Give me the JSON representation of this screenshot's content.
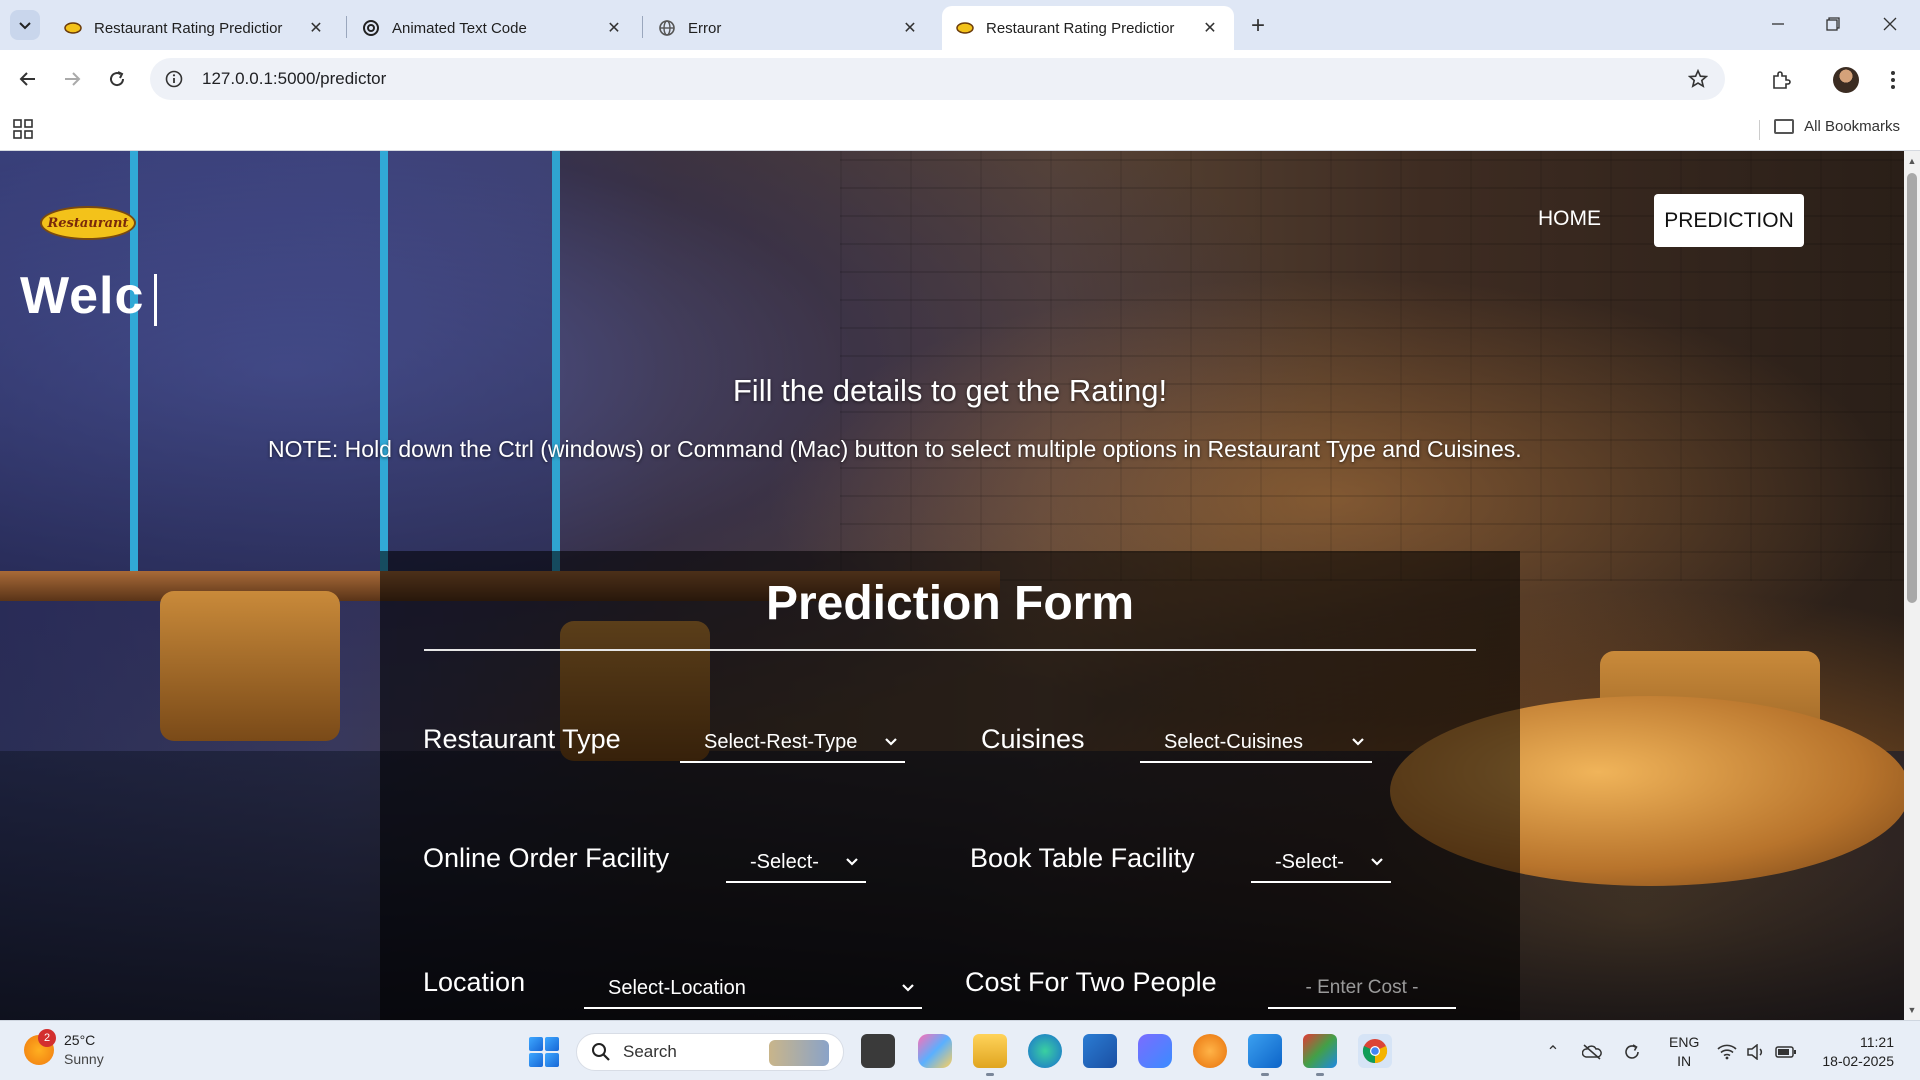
{
  "browser": {
    "tabs": [
      {
        "title": "Restaurant Rating Predictior",
        "active": false
      },
      {
        "title": "Animated Text Code",
        "active": false
      },
      {
        "title": "Error",
        "active": false
      },
      {
        "title": "Restaurant Rating Predictior",
        "active": true
      }
    ],
    "url": "127.0.0.1:5000/predictor",
    "bookmarks_label": "All Bookmarks"
  },
  "site": {
    "logo_text": "Restaurant",
    "nav": {
      "home": "HOME",
      "prediction": "PREDICTION"
    },
    "welcome_text": "Welc",
    "headline": "Fill the details to get the Rating!",
    "note": "NOTE: Hold down the Ctrl (windows) or Command (Mac) button to select multiple options in Restaurant Type and Cuisines.",
    "form": {
      "title": "Prediction Form",
      "fields": {
        "restaurant_type": {
          "label": "Restaurant Type",
          "value": "Select-Rest-Type"
        },
        "cuisines": {
          "label": "Cuisines",
          "value": "Select-Cuisines"
        },
        "online_order": {
          "label": "Online Order Facility",
          "value": "-Select-"
        },
        "book_table": {
          "label": "Book Table Facility",
          "value": "-Select-"
        },
        "location": {
          "label": "Location",
          "value": "Select-Location"
        },
        "cost": {
          "label": "Cost For Two People",
          "placeholder": "- Enter Cost -"
        }
      }
    }
  },
  "taskbar": {
    "weather": {
      "temp": "25°C",
      "condition": "Sunny",
      "badge": "2"
    },
    "search_label": "Search",
    "lang": {
      "line1": "ENG",
      "line2": "IN"
    },
    "clock": {
      "time": "11:21",
      "date": "18-02-2025"
    }
  },
  "colors": {
    "accent": "#1a73e8",
    "tab_bar": "#dfe7f5",
    "form_panel": "rgba(0,0,0,0.55)"
  }
}
